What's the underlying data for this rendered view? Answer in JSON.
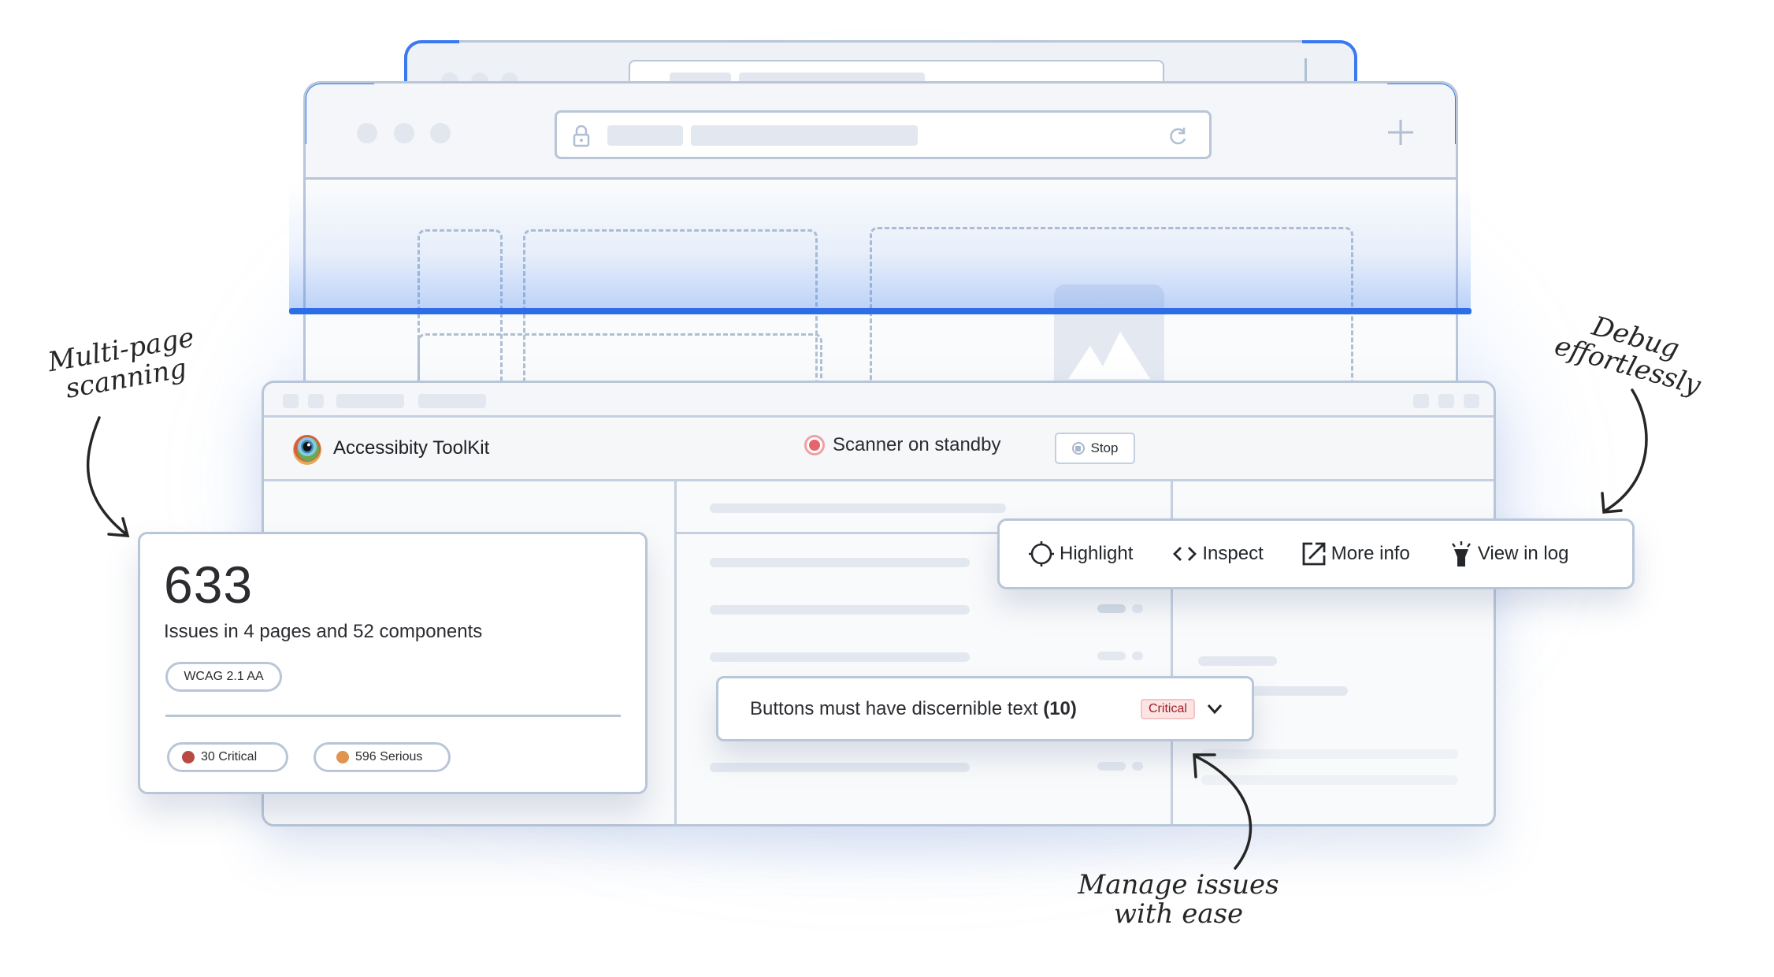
{
  "annotations": {
    "multi_page": [
      "Multi-page",
      "scanning"
    ],
    "debug": [
      "Debug",
      "effortlessly"
    ],
    "manage": [
      "Manage issues",
      "with ease"
    ]
  },
  "toolkit": {
    "app_name": "Accessibity ToolKit",
    "status_text": "Scanner on standby",
    "stop_label": "Stop"
  },
  "stats": {
    "total_issues": "633",
    "summary": "Issues in 4 pages and 52 components",
    "standard": "WCAG 2.1 AA",
    "severities": [
      {
        "label": "30 Critical",
        "color": "#b84a44"
      },
      {
        "label": "596 Serious",
        "color": "#e0944f"
      }
    ]
  },
  "actions": [
    {
      "label": "Highlight",
      "icon": "crosshair-icon"
    },
    {
      "label": "Inspect",
      "icon": "code-icon"
    },
    {
      "label": "More info",
      "icon": "external-link-icon"
    },
    {
      "label": "View in log",
      "icon": "flashlight-icon"
    }
  ],
  "issue": {
    "title": "Buttons must have discernible text",
    "count": "(10)",
    "severity": "Critical"
  },
  "colors": {
    "accent": "#2d6ee8",
    "critical": "#b84a44",
    "serious": "#e0944f"
  }
}
